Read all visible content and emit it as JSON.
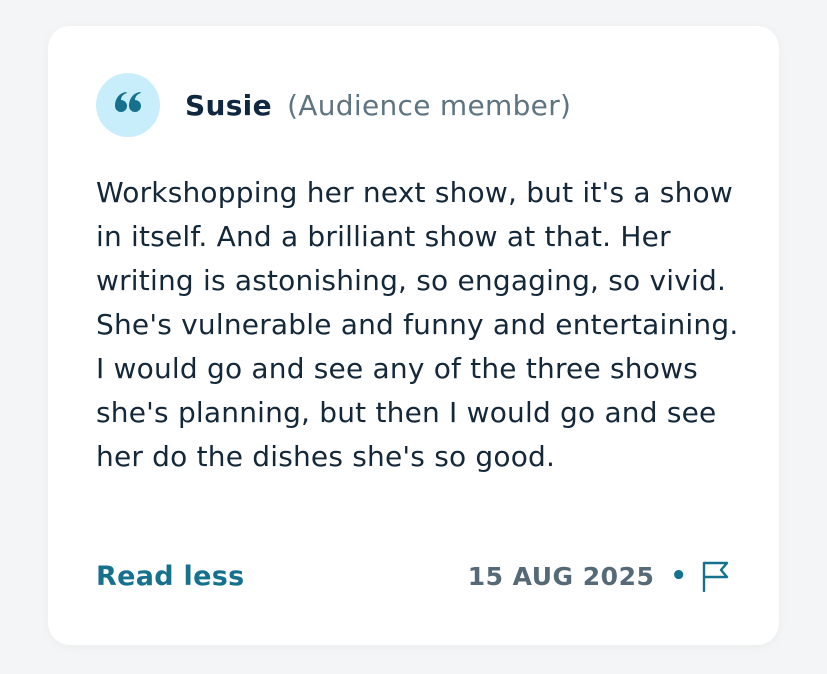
{
  "review": {
    "author_name": "Susie",
    "author_role": "(Audience member)",
    "quote_icon": "quote-icon",
    "text": "Workshopping her next show, but it's a show in itself.  And a brilliant show at that. Her writing is astonishing, so engaging, so vivid. She's vulnerable and funny and entertaining. I would go and see any of the three shows she's planning, but then I would go and see her do the dishes she's so good.",
    "toggle_label": "Read less",
    "date": "15 AUG 2025",
    "separator": "•",
    "report_icon": "flag-icon"
  },
  "colors": {
    "avatar_bg": "#c9eefb",
    "accent": "#16718f",
    "name": "#0f2740",
    "role": "#5f7482",
    "body_text": "#14283a",
    "date": "#556977"
  }
}
